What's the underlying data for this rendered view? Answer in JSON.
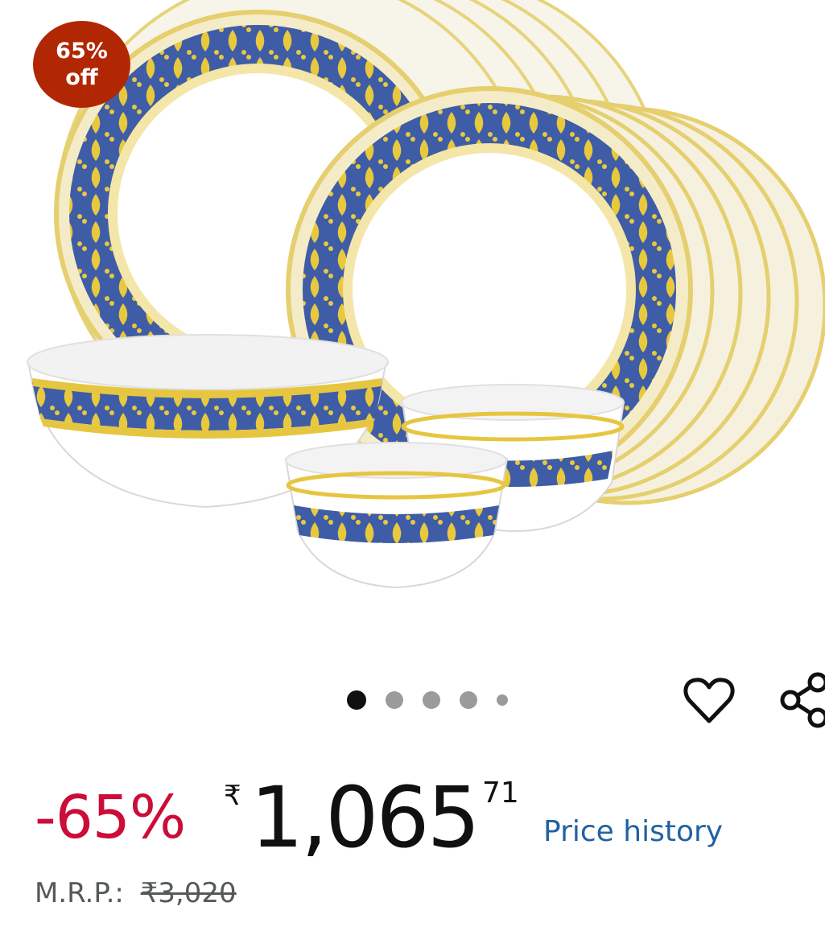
{
  "product": {
    "image_alt": "Opalware dinner set: stacked plates, serving bowl and small bowls with blue and yellow border",
    "badge": {
      "line1": "65%",
      "line2": "off"
    },
    "carousel": {
      "count": 5,
      "active_index": 0
    }
  },
  "actions": {
    "wishlist_icon": "heart-icon",
    "share_icon": "share-icon"
  },
  "price": {
    "discount": "-65%",
    "currency": "₹",
    "whole": "1,065",
    "fraction": "71",
    "history_link": "Price history"
  },
  "mrp": {
    "label": "M.R.P.:",
    "value": "₹3,020"
  },
  "colors": {
    "badge": "#b12704",
    "discount": "#cc0c39",
    "link": "#2162a1",
    "border_blue": "#3f5da6",
    "border_gold": "#e6c640"
  }
}
